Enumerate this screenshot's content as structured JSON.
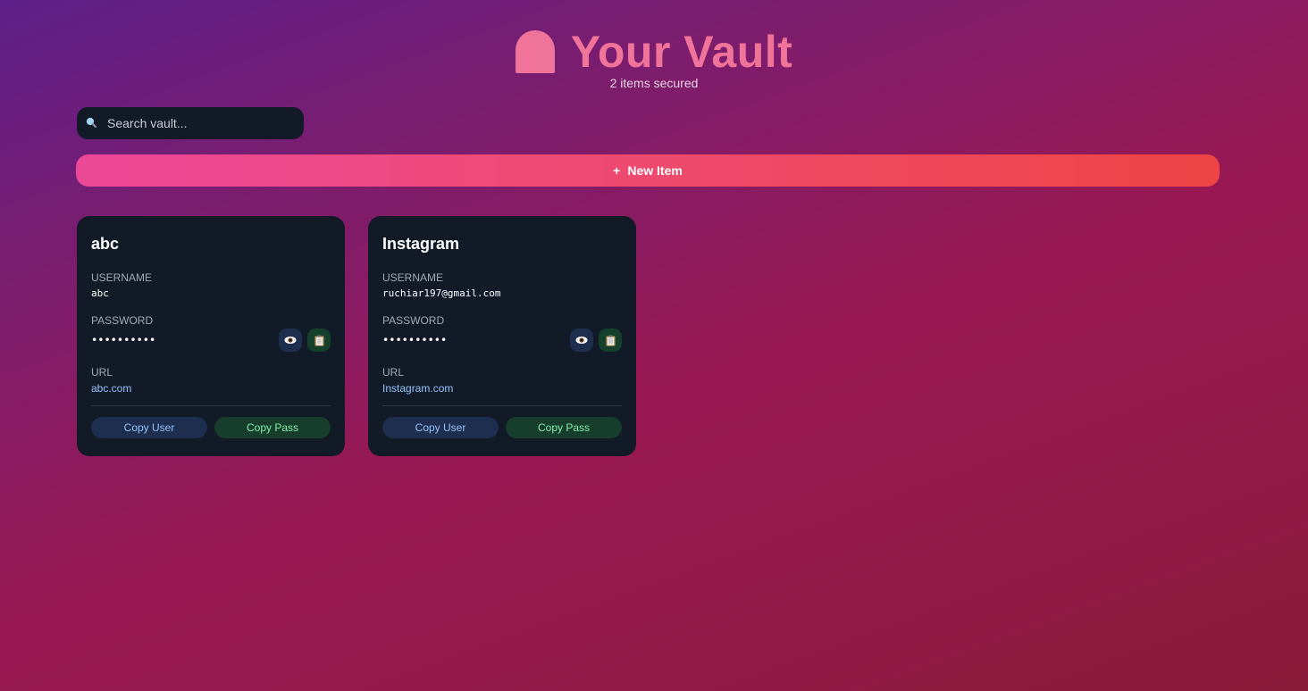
{
  "header": {
    "title": "Your Vault",
    "subtitle": "2 items secured",
    "lock_icon": "lock-icon",
    "accent_color": "#f0749a"
  },
  "search": {
    "placeholder": "Search vault...",
    "value": "",
    "icon": "magnifier-icon"
  },
  "toolbar": {
    "new_item_plus": "+",
    "new_item_label": "New Item"
  },
  "labels": {
    "username": "USERNAME",
    "password": "PASSWORD",
    "url": "URL",
    "copy_user": "Copy User",
    "copy_pass": "Copy Pass"
  },
  "items": [
    {
      "title": "abc",
      "username": "abc",
      "password_masked": "••••••••••",
      "url": "abc.com"
    },
    {
      "title": "Instagram",
      "username": "ruchiar197@gmail.com",
      "password_masked": "••••••••••",
      "url": "Instagram.com"
    }
  ],
  "colors": {
    "card_bg": "#121a27",
    "link": "#93c5fd",
    "copy_pass_text": "#86efac"
  }
}
